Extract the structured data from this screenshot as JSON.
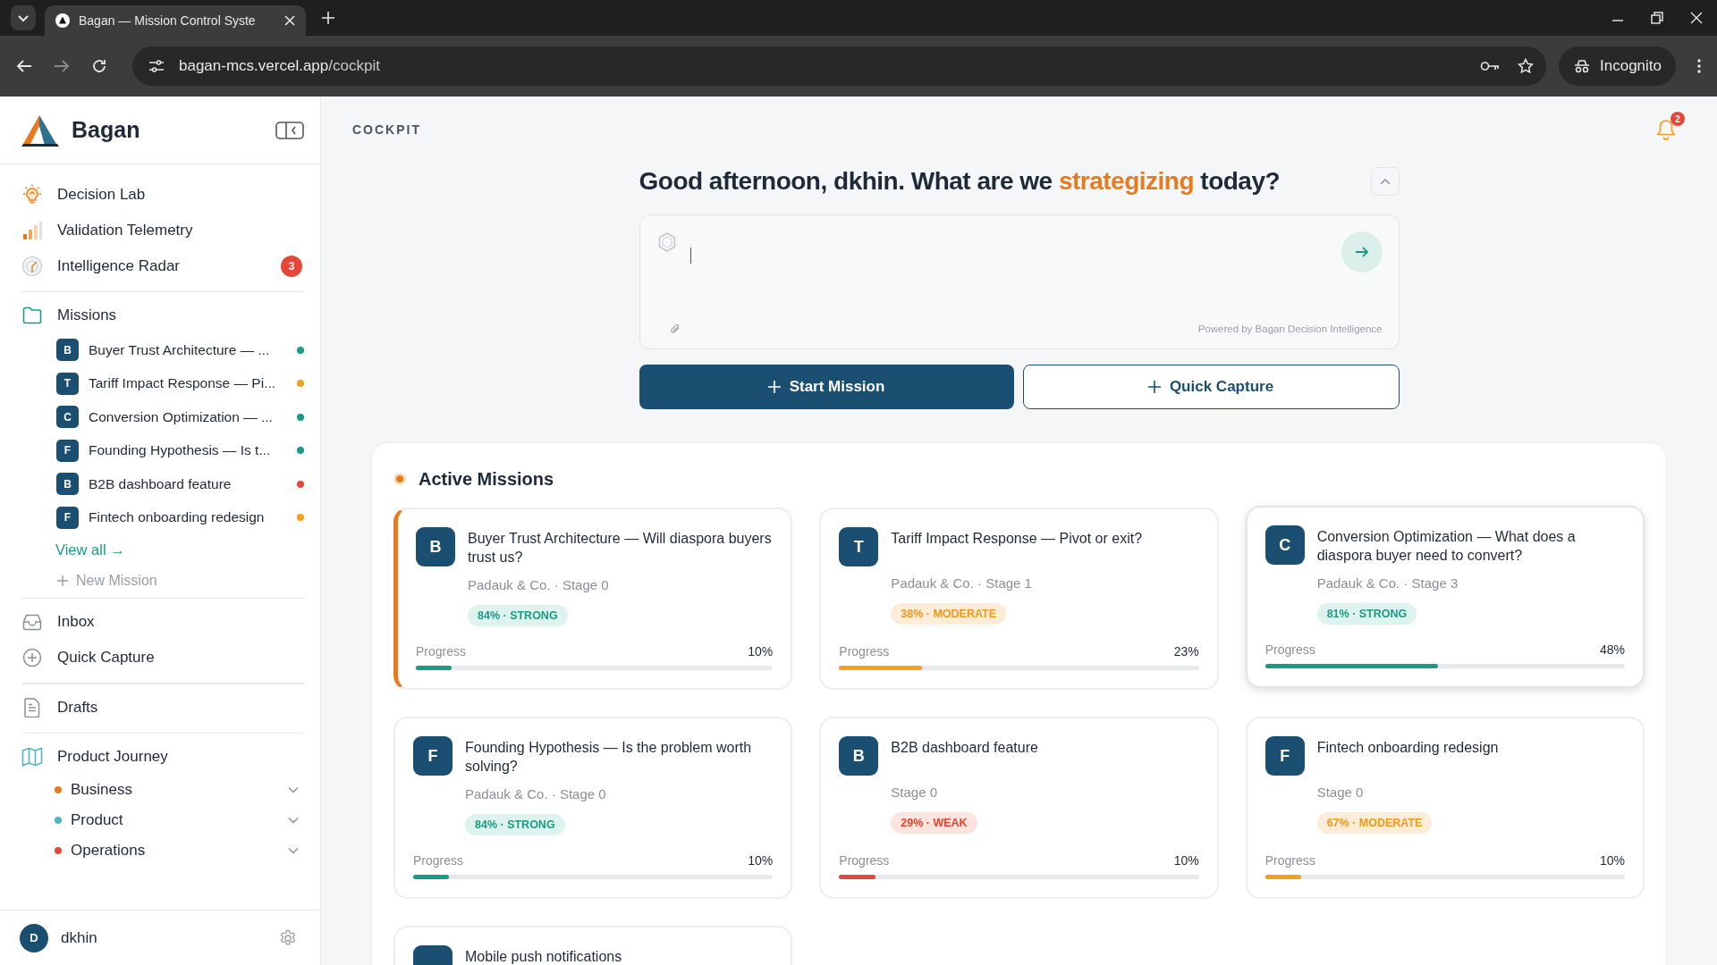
{
  "browser": {
    "tab_title": "Bagan — Mission Control Syste",
    "url_host": "bagan-mcs.vercel.app",
    "url_path": "/cockpit",
    "profile": "Incognito"
  },
  "sidebar": {
    "brand": "Bagan",
    "nav": [
      {
        "label": "Decision Lab"
      },
      {
        "label": "Validation Telemetry"
      },
      {
        "label": "Intelligence Radar",
        "badge": "3"
      }
    ],
    "missions": {
      "label": "Missions",
      "items": [
        {
          "initial": "B",
          "title": "Buyer Trust Architecture — ...",
          "color": "#1a9c84"
        },
        {
          "initial": "T",
          "title": "Tariff Impact Response — Pi...",
          "color": "#f5a01a"
        },
        {
          "initial": "C",
          "title": "Conversion Optimization — ...",
          "color": "#1a9c84"
        },
        {
          "initial": "F",
          "title": "Founding Hypothesis — Is t...",
          "color": "#1a9c84"
        },
        {
          "initial": "B",
          "title": "B2B dashboard feature",
          "color": "#e5483b"
        },
        {
          "initial": "F",
          "title": "Fintech onboarding redesign",
          "color": "#f5a01a"
        }
      ],
      "view_all": "View all →",
      "new_mission": "New Mission"
    },
    "tools": [
      {
        "label": "Inbox"
      },
      {
        "label": "Quick Capture"
      }
    ],
    "drafts": "Drafts",
    "journey": {
      "label": "Product Journey",
      "children": [
        {
          "label": "Business",
          "color": "#ea7a1e",
          "expanded": false
        },
        {
          "label": "Product",
          "color": "#4db6c1",
          "expanded": false
        },
        {
          "label": "Operations",
          "color": "#e5483b",
          "expanded": false
        }
      ]
    },
    "user": {
      "initial": "D",
      "name": "dkhin"
    }
  },
  "main": {
    "page_label": "COCKPIT",
    "notifications": "2",
    "greeting": {
      "before": "Good afternoon, dkhin. What are we ",
      "highlight": "strategizing",
      "after": " today?"
    },
    "composer": {
      "footer": "Powered by Bagan Decision Intelligence"
    },
    "actions": [
      {
        "label": "Start Mission",
        "kind": "primary"
      },
      {
        "label": "Quick Capture",
        "kind": "secondary"
      }
    ],
    "active_missions": {
      "title": "Active Missions",
      "cards": [
        {
          "initial": "B",
          "title": "Buyer Trust Architecture — Will diaspora buyers trust us?",
          "meta": "Padauk & Co. · Stage 0",
          "tag": "84% · STRONG",
          "kind": "strong",
          "progress_label": "Progress",
          "percent": "10%",
          "level": 0.1,
          "selected": true,
          "hovered": false
        },
        {
          "initial": "T",
          "title": "Tariff Impact Response — Pivot or exit?",
          "meta": "Padauk & Co. · Stage 1",
          "tag": "38% · MODERATE",
          "kind": "moderate",
          "progress_label": "Progress",
          "percent": "23%",
          "level": 0.23,
          "selected": false,
          "hovered": false
        },
        {
          "initial": "C",
          "title": "Conversion Optimization — What does a diaspora buyer need to convert?",
          "meta": "Padauk & Co. · Stage 3",
          "tag": "81% · STRONG",
          "kind": "strong",
          "progress_label": "Progress",
          "percent": "48%",
          "level": 0.48,
          "selected": false,
          "hovered": true
        },
        {
          "initial": "F",
          "title": "Founding Hypothesis — Is the problem worth solving?",
          "meta": "Padauk & Co. · Stage 0",
          "tag": "84% · STRONG",
          "kind": "strong",
          "progress_label": "Progress",
          "percent": "10%",
          "level": 0.1,
          "selected": false,
          "hovered": false
        },
        {
          "initial": "B",
          "title": "B2B dashboard feature",
          "meta": "Stage 0",
          "tag": "29% · WEAK",
          "kind": "weak",
          "progress_label": "Progress",
          "percent": "10%",
          "level": 0.1,
          "selected": false,
          "hovered": false
        },
        {
          "initial": "F",
          "title": "Fintech onboarding redesign",
          "meta": "Stage 0",
          "tag": "67% · MODERATE",
          "kind": "moderate",
          "progress_label": "Progress",
          "percent": "10%",
          "level": 0.1,
          "selected": false,
          "hovered": false
        },
        {
          "title": "Mobile push notifications",
          "selected": false,
          "hovered": false
        }
      ]
    }
  }
}
